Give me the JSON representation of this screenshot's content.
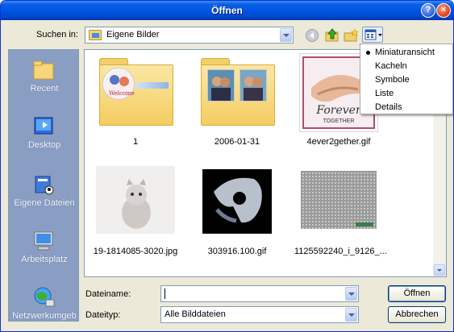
{
  "window": {
    "title": "Öffnen",
    "help_glyph": "?",
    "close_glyph": "×"
  },
  "lookin": {
    "label": "Suchen in:",
    "value": "Eigene Bilder"
  },
  "places": [
    {
      "label": "Recent",
      "icon": "recent-folder-icon"
    },
    {
      "label": "Desktop",
      "icon": "desktop-icon"
    },
    {
      "label": "Eigene Dateien",
      "icon": "my-documents-icon"
    },
    {
      "label": "Arbeitsplatz",
      "icon": "my-computer-icon"
    },
    {
      "label": "Netzwerkumgeb",
      "icon": "network-icon"
    }
  ],
  "files": [
    {
      "name": "1",
      "type": "folder"
    },
    {
      "name": "2006-01-31",
      "type": "folder"
    },
    {
      "name": "4ever2gether.gif",
      "type": "image",
      "thumb_text": "Forever",
      "thumb_subtext": "TOGETHER"
    },
    {
      "name": "19-1814085-3020.jpg",
      "type": "image"
    },
    {
      "name": "303916.100.gif",
      "type": "image"
    },
    {
      "name": "1125592240_i_9126_...",
      "type": "image"
    }
  ],
  "folder1_thumb_text": "Welcome",
  "view_menu": {
    "items": [
      {
        "label": "Miniaturansicht",
        "selected": true
      },
      {
        "label": "Kacheln",
        "selected": false
      },
      {
        "label": "Symbole",
        "selected": false
      },
      {
        "label": "Liste",
        "selected": false
      },
      {
        "label": "Details",
        "selected": false
      }
    ]
  },
  "filename": {
    "label": "Dateiname:",
    "value": ""
  },
  "filetype": {
    "label": "Dateityp:",
    "value": "Alle Bilddateien"
  },
  "buttons": {
    "open": "Öffnen",
    "cancel": "Abbrechen"
  },
  "colors": {
    "titlebar": "#0055e5",
    "places_bg": "#8a9ec4",
    "dialog_bg": "#ece9d8"
  }
}
